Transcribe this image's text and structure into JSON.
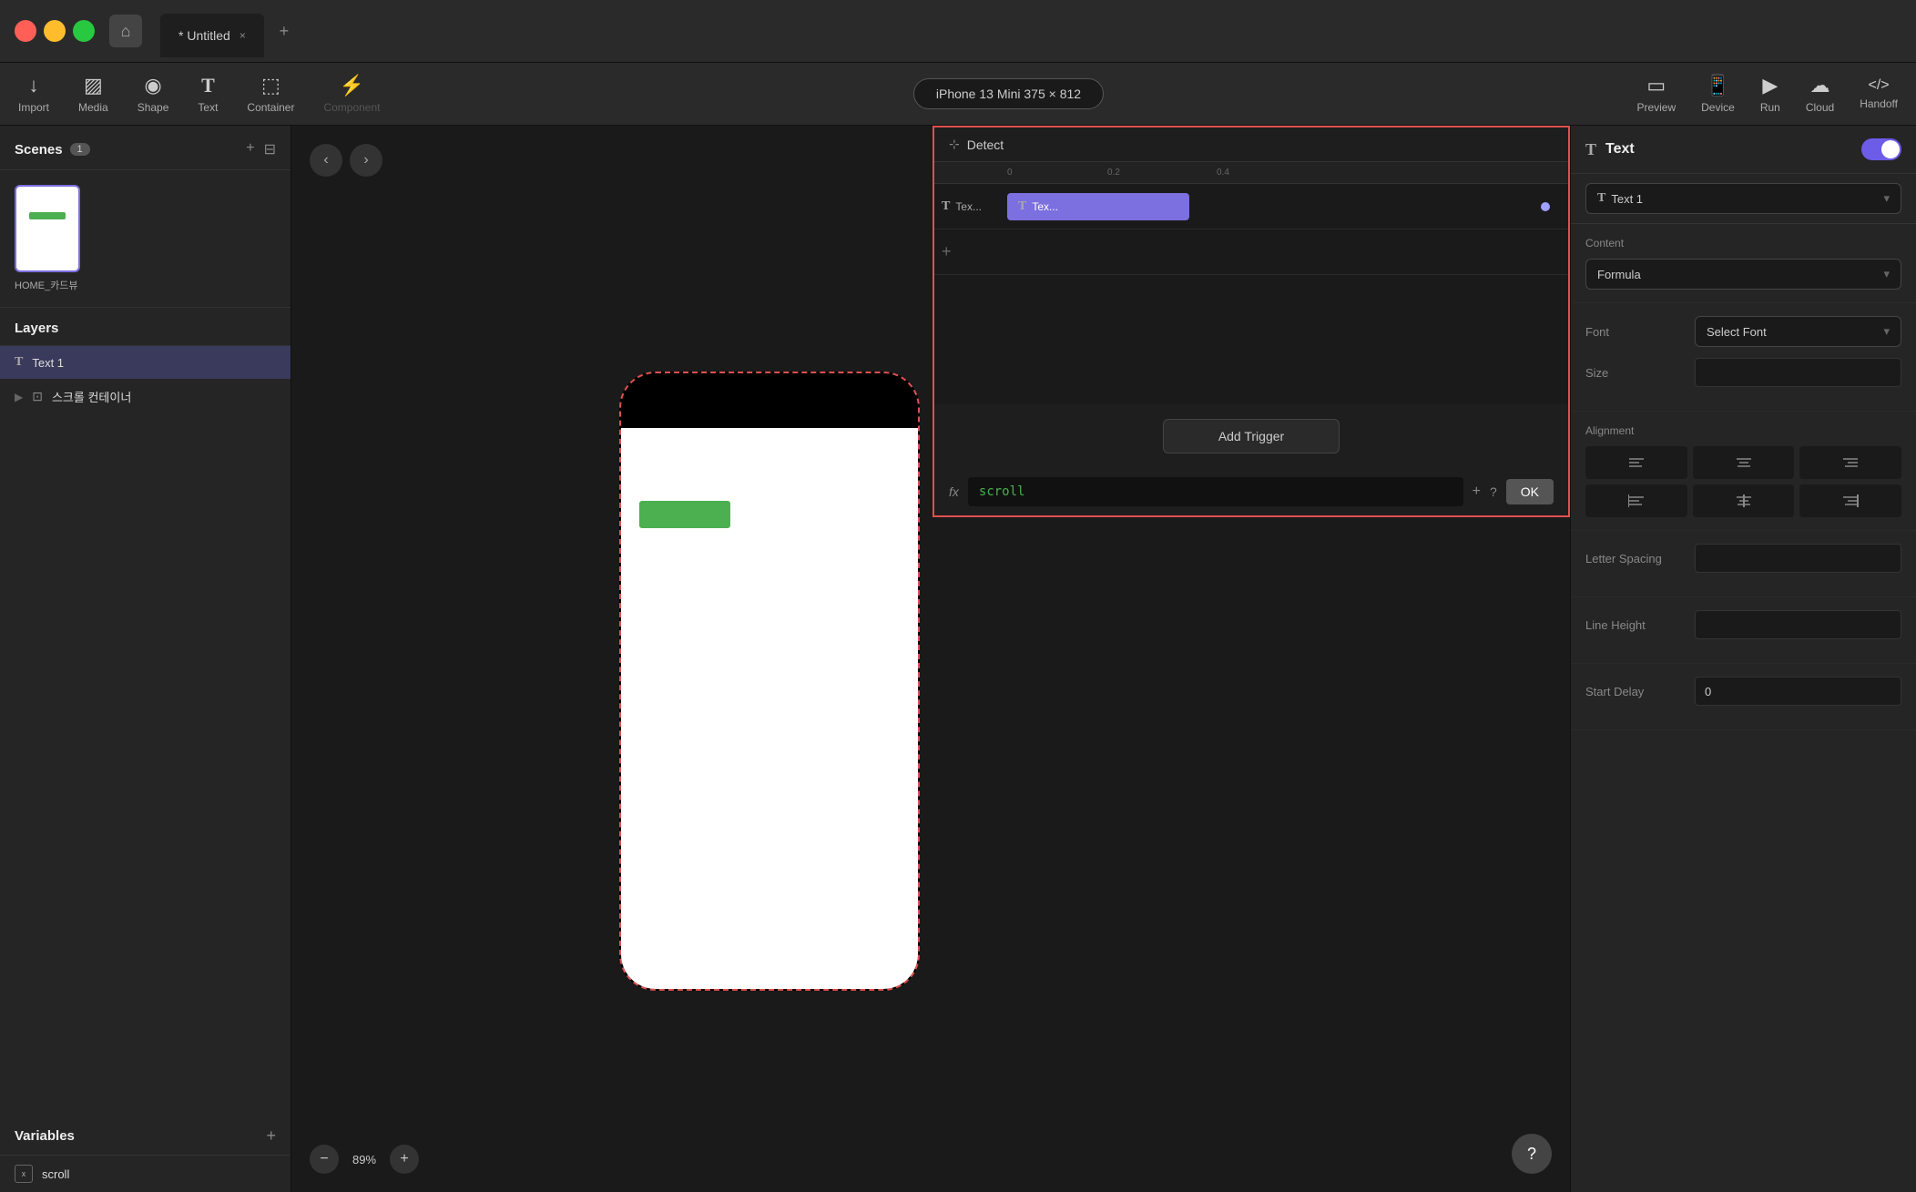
{
  "titlebar": {
    "tab_title": "* Untitled",
    "tab_close": "×",
    "tab_add": "+"
  },
  "toolbar": {
    "import_label": "Import",
    "media_label": "Media",
    "shape_label": "Shape",
    "text_label": "Text",
    "container_label": "Container",
    "component_label": "Component",
    "device_selector": "iPhone 13 Mini  375 × 812",
    "preview_label": "Preview",
    "device_label": "Device",
    "run_label": "Run",
    "cloud_label": "Cloud",
    "handoff_label": "Handoff"
  },
  "left_panel": {
    "scenes_title": "Scenes",
    "scenes_count": "1",
    "scene_name": "HOME_카드뷰",
    "layers_title": "Layers",
    "layer_items": [
      {
        "icon": "T",
        "name": "Text 1",
        "selected": true
      },
      {
        "icon": "⊡",
        "name": "스크롤 컨테이너",
        "selected": false,
        "has_expand": true
      }
    ],
    "variables_title": "Variables",
    "variable_items": [
      {
        "icon": "x",
        "name": "scroll"
      }
    ]
  },
  "detect_panel": {
    "title": "Detect",
    "ruler_marks": [
      "0",
      "0.2",
      "0.4"
    ],
    "timeline_items": [
      {
        "icon": "T",
        "label": "Tex...",
        "bar_text": "T  Tex...",
        "has_dot": true
      }
    ],
    "add_trigger_label": "Add Trigger",
    "formula_prefix": "fx",
    "formula_value": "scroll",
    "formula_plus": "+",
    "formula_question": "?",
    "formula_ok": "OK"
  },
  "right_panel": {
    "title": "Text",
    "layer_select_label": "T  Text 1",
    "content_label": "Content",
    "content_type": "Formula",
    "font_label": "Font",
    "font_value": "Select Font",
    "size_label": "Size",
    "alignment_label": "Alignment",
    "letter_spacing_label": "Letter Spacing",
    "line_height_label": "Line Height",
    "start_delay_label": "Start Delay",
    "start_delay_value": "0"
  },
  "canvas": {
    "scene_label": "HOME_카드뷰",
    "zoom_value": "89%",
    "zoom_minus": "−",
    "zoom_plus": "+",
    "help": "?"
  },
  "icons": {
    "import": "↓",
    "media": "🖼",
    "shape": "⬤",
    "text": "T",
    "container": "⬜",
    "component": "⚡",
    "preview": "▭",
    "device": "📱",
    "run": "▶",
    "cloud": "☁",
    "handoff": "</>",
    "back": "‹",
    "forward": "›",
    "detect_icon": "⊹",
    "fx": "fx",
    "align_left_top": "≡",
    "align_center_top": "≡",
    "align_right_top": "≡",
    "align_left_mid": "≡",
    "align_center_mid": "≡",
    "align_right_mid": "≡"
  }
}
